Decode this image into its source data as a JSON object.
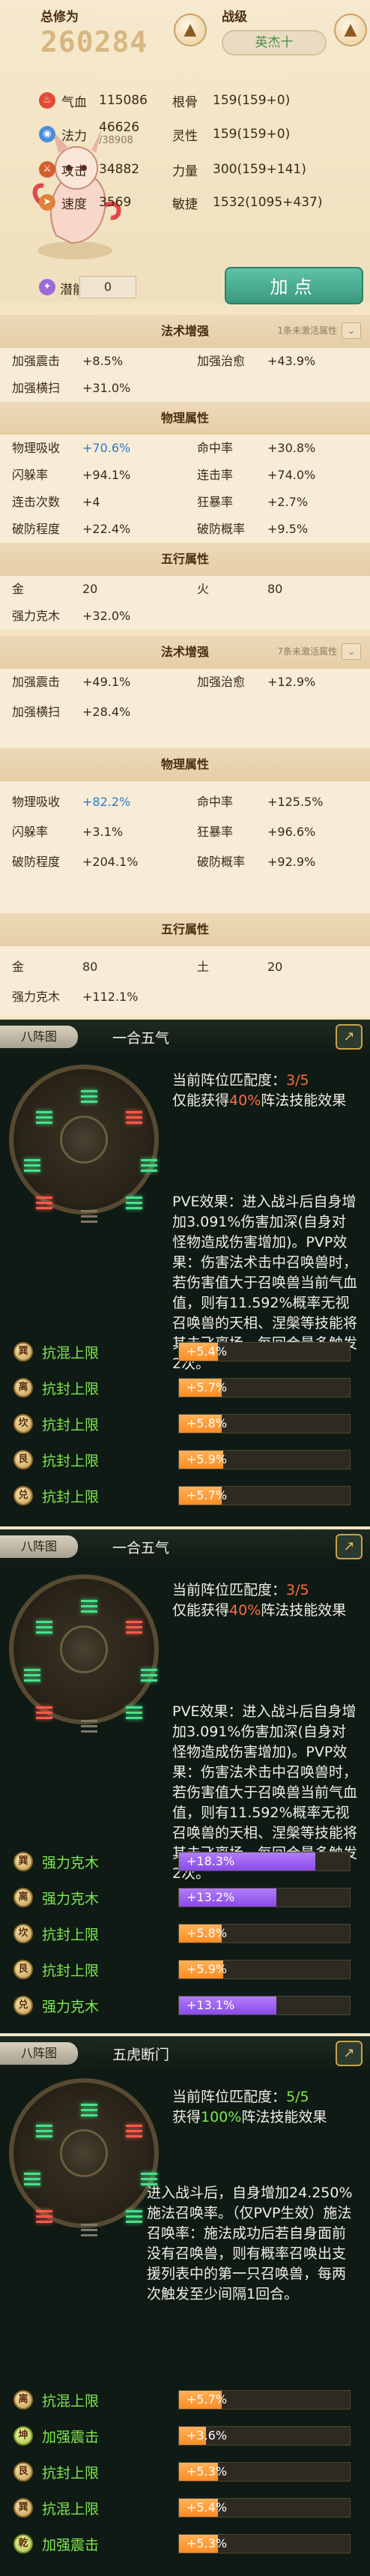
{
  "header": {
    "total_label": "总修为",
    "total_value": "260284",
    "rank_label": "战级",
    "rank_value": "英杰十"
  },
  "stats": [
    {
      "icon": "fire-icon",
      "label": "气血",
      "value": "115086",
      "sub": ""
    },
    {
      "icon": "water-icon",
      "label": "法力",
      "value": "46626",
      "sub": "/38908"
    },
    {
      "icon": "attack-icon",
      "label": "攻击",
      "value": "34882",
      "sub": ""
    },
    {
      "icon": "speed-icon",
      "label": "速度",
      "value": "3569",
      "sub": ""
    }
  ],
  "stats_right": [
    {
      "label": "根骨",
      "value": "159(159+0)"
    },
    {
      "label": "灵性",
      "value": "159(159+0)"
    },
    {
      "label": "力量",
      "value": "300(159+141)"
    },
    {
      "label": "敏捷",
      "value": "1532(1095+437)"
    }
  ],
  "potential": {
    "label": "潜能",
    "value": "0"
  },
  "add_button": "加点",
  "block1": {
    "magic_title": "法术增强",
    "magic_tag": "1条未激活属性",
    "magic_rows": [
      [
        "加强震击",
        "+8.5%",
        "加强治愈",
        "+43.9%"
      ],
      [
        "加强横扫",
        "+31.0%",
        "",
        ""
      ]
    ],
    "phys_title": "物理属性",
    "phys_rows": [
      [
        "物理吸收",
        "+70.6%",
        "命中率",
        "+30.8%"
      ],
      [
        "闪躲率",
        "+94.1%",
        "连击率",
        "+74.0%"
      ],
      [
        "连击次数",
        "+4",
        "狂暴率",
        "+2.7%"
      ],
      [
        "破防程度",
        "+22.4%",
        "破防概率",
        "+9.5%"
      ]
    ],
    "five_title": "五行属性",
    "five_rows": [
      [
        "金",
        "20",
        "火",
        "80"
      ],
      [
        "强力克木",
        "+32.0%",
        "",
        ""
      ]
    ]
  },
  "block2": {
    "magic_title": "法术增强",
    "magic_tag": "7条未激活属性",
    "magic_rows": [
      [
        "加强震击",
        "+49.1%",
        "加强治愈",
        "+12.9%"
      ],
      [
        "加强横扫",
        "+28.4%",
        "",
        ""
      ]
    ],
    "phys_title": "物理属性",
    "phys_rows": [
      [
        "物理吸收",
        "+82.2%",
        "命中率",
        "+125.5%"
      ],
      [
        "闪躲率",
        "+3.1%",
        "狂暴率",
        "+96.6%"
      ],
      [
        "破防程度",
        "+204.1%",
        "破防概率",
        "+92.9%"
      ]
    ],
    "five_title": "五行属性",
    "five_rows": [
      [
        "金",
        "80",
        "土",
        "20"
      ],
      [
        "强力克木",
        "+112.1%",
        "",
        ""
      ]
    ]
  },
  "formations": [
    {
      "tab": "八阵图",
      "name": "一合五气",
      "match_line": "当前阵位匹配度：",
      "match_value": "3/5",
      "gain_pre": "仅能获得",
      "gain_value": "40%",
      "gain_post": "阵法技能效果",
      "desc": "PVE效果：进入战斗后自身增加3.091%伤害加深(自身对怪物造成伤害增加)。PVP效果：伤害法术击中召唤兽时，若伤害值大于召唤兽当前气血值，则有11.592%概率无视召唤兽的天相、涅槃等技能将其击飞离场，每回合最多触发2次。",
      "attrs": [
        {
          "gua": "巽",
          "name": "抗混上限",
          "value": "+5.4%",
          "level": 0.23
        },
        {
          "gua": "离",
          "name": "抗封上限",
          "value": "+5.7%",
          "level": 0.25
        },
        {
          "gua": "坎",
          "name": "抗封上限",
          "value": "+5.8%",
          "level": 0.25
        },
        {
          "gua": "艮",
          "name": "抗封上限",
          "value": "+5.9%",
          "level": 0.26
        },
        {
          "gua": "兑",
          "name": "抗封上限",
          "value": "+5.7%",
          "level": 0.25
        }
      ]
    },
    {
      "tab": "八阵图",
      "name": "一合五气",
      "match_line": "当前阵位匹配度：",
      "match_value": "3/5",
      "gain_pre": "仅能获得",
      "gain_value": "40%",
      "gain_post": "阵法技能效果",
      "desc": "PVE效果：进入战斗后自身增加3.091%伤害加深(自身对怪物造成伤害增加)。PVP效果：伤害法术击中召唤兽时，若伤害值大于召唤兽当前气血值，则有11.592%概率无视召唤兽的天相、涅槃等技能将其击飞离场，每回合最多触发2次。",
      "attrs": [
        {
          "gua": "巽",
          "name": "强力克木",
          "value": "+18.3%",
          "level": 0.8
        },
        {
          "gua": "离",
          "name": "强力克木",
          "value": "+13.2%",
          "level": 0.57
        },
        {
          "gua": "坎",
          "name": "抗封上限",
          "value": "+5.8%",
          "level": 0.25
        },
        {
          "gua": "艮",
          "name": "抗封上限",
          "value": "+5.9%",
          "level": 0.26
        },
        {
          "gua": "兑",
          "name": "强力克木",
          "value": "+13.1%",
          "level": 0.57
        }
      ]
    },
    {
      "tab": "八阵图",
      "name": "五虎断门",
      "match_line": "当前阵位匹配度：",
      "match_value": "5/5",
      "gain_pre": "获得",
      "gain_value": "100%",
      "gain_post": "阵法技能效果",
      "desc": "进入战斗后，自身增加24.250%施法召唤率。（仅PVP生效）施法召唤率：施法成功后若自身面前没有召唤兽，则有概率召唤出支援列表中的第一只召唤兽，每两次触发至少间隔1回合。",
      "attrs": [
        {
          "gua": "离",
          "name": "抗混上限",
          "value": "+5.7%",
          "level": 0.25
        },
        {
          "gua": "坤",
          "name": "加强震击",
          "value": "+3.6%",
          "level": 0.16
        },
        {
          "gua": "艮",
          "name": "抗封上限",
          "value": "+5.3%",
          "level": 0.23
        },
        {
          "gua": "巽",
          "name": "抗混上限",
          "value": "+5.4%",
          "level": 0.23
        },
        {
          "gua": "乾",
          "name": "加强震击",
          "value": "+5.3%",
          "level": 0.23
        }
      ]
    }
  ],
  "colors": {
    "accent_green": "#7ee84d",
    "bar_orange": "#ff8c22",
    "bar_red": "#e55a3c",
    "bar_purple": "#8a4be8",
    "button_teal": "#3a9a7e"
  }
}
